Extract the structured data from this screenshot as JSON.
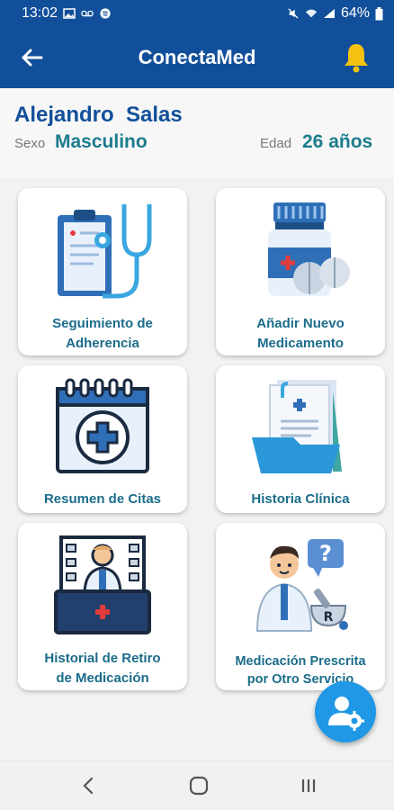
{
  "status_bar": {
    "time": "13:02",
    "battery": "64%"
  },
  "app_bar": {
    "title": "ConectaMed"
  },
  "profile": {
    "name": "Alejandro  Salas",
    "sex_label": "Sexo",
    "sex_value": "Masculino",
    "age_label": "Edad",
    "age_value": "26 años"
  },
  "menu": {
    "items": [
      {
        "label_line1": "Seguimiento de",
        "label_line2": "Adherencia",
        "icon": "clipboard-stethoscope-icon"
      },
      {
        "label_line1": "Añadir Nuevo",
        "label_line2": "Medicamento",
        "icon": "medicine-bottle-icon"
      },
      {
        "label_line1": "Resumen de Citas",
        "icon": "calendar-medical-icon"
      },
      {
        "label_line1": "Historia Clínica",
        "icon": "medical-folder-icon"
      },
      {
        "label_line1": "Historial de Retiro",
        "label_line2": "de Medicación",
        "icon": "pharmacist-counter-icon"
      },
      {
        "label_line1": "Medicación Prescrita",
        "label_line2": "por Otro Servicio",
        "icon": "doctor-prescription-icon"
      }
    ]
  },
  "fab": {
    "icon": "user-settings-icon"
  },
  "nav": {
    "back_icon": "nav-back-icon",
    "home_icon": "nav-home-icon",
    "recents_icon": "nav-recents-icon"
  },
  "colors": {
    "primary": "#124f9a",
    "accent_text": "#1b7c8d",
    "fab": "#2098e6",
    "bell": "#f5c211"
  }
}
